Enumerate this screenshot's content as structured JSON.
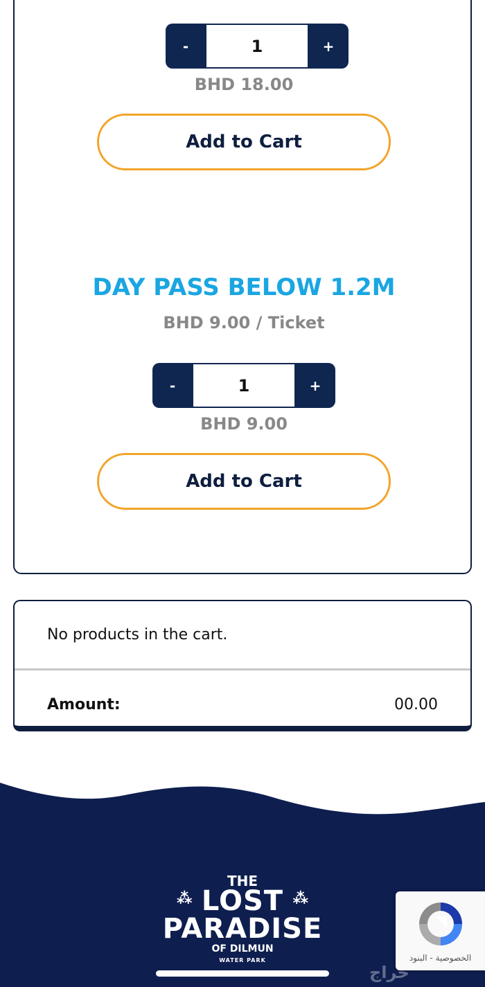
{
  "products": [
    {
      "qty_minus": "-",
      "qty_value": "1",
      "qty_plus": "+",
      "total": "BHD 18.00",
      "add_to_cart": "Add to Cart"
    },
    {
      "name": "DAY PASS BELOW 1.2M",
      "unit_price": "BHD 9.00 / Ticket",
      "qty_minus": "-",
      "qty_value": "1",
      "qty_plus": "+",
      "total": "BHD 9.00",
      "add_to_cart": "Add to Cart"
    }
  ],
  "cart": {
    "empty_message": "No products in the cart.",
    "amount_label": "Amount:",
    "amount_value": "00.00"
  },
  "footer": {
    "logo": {
      "line1": "THE",
      "line2": "LOST",
      "line3": "PARADISE",
      "line4": "OF DILMUN",
      "line5": "WATER PARK"
    }
  },
  "recaptcha": {
    "label": "الخصوصية - البنود",
    "icon": "recaptcha-icon"
  },
  "watermark": "حراج",
  "colors": {
    "navy": "#0e2650",
    "accent_orange": "#f2a52a",
    "title_blue": "#1aa6e2",
    "price_gray": "#888888"
  }
}
